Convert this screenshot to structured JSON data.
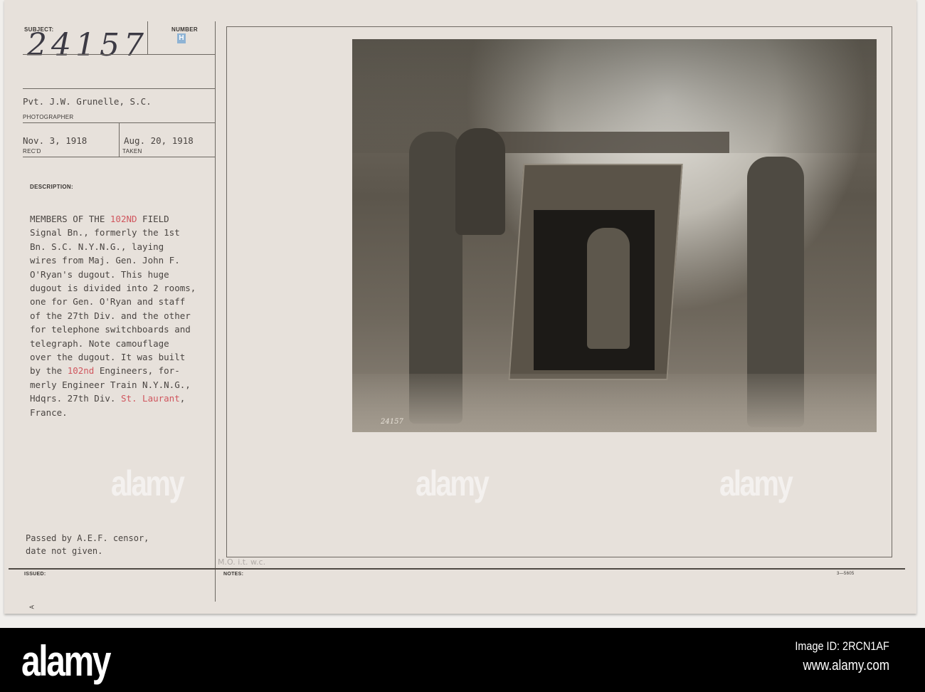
{
  "card": {
    "subject_label": "SUBJECT:",
    "subject_number": "24157",
    "number_label": "NUMBER",
    "number_stamp": "H",
    "photographer": "Pvt. J.W. Grunelle, S.C.",
    "photographer_label": "PHOTOGRAPHER",
    "received_date": "Nov. 3, 1918",
    "received_label": "REC'D",
    "taken_date": "Aug. 20, 1918",
    "taken_label": "TAKEN",
    "description_label": "DESCRIPTION:",
    "description_lines": [
      [
        "MEMBERS OF THE ",
        "102ND",
        " FIELD"
      ],
      [
        "Signal Bn., formerly the 1st"
      ],
      [
        "Bn. S.C. N.Y.N.G., laying"
      ],
      [
        "wires from Maj. Gen. John F."
      ],
      [
        "O'Ryan's dugout. This huge"
      ],
      [
        "dugout is divided into 2 rooms,"
      ],
      [
        "one for Gen. O'Ryan and staff"
      ],
      [
        "of the 27th Div. and the other"
      ],
      [
        "for telephone switchboards and"
      ],
      [
        "telegraph. Note camouflage"
      ],
      [
        "over the dugout. It was built"
      ],
      [
        "by the ",
        "102nd",
        " Engineers, for-"
      ],
      [
        "merly Engineer Train N.Y.N.G.,"
      ],
      [
        "Hdqrs. 27th Div. ",
        "St. Laurant",
        ","
      ],
      [
        "France."
      ]
    ],
    "censor_line1": "Passed by A.E.F. censor,",
    "censor_line2": "date not given.",
    "pencil_note": "M.O. i.t. w.c.",
    "issued_label": "ISSUED:",
    "notes_label": "NOTES:",
    "form_number": "3—5605",
    "corner_mark": "A",
    "photo_caption_number": "24157",
    "highlight_color": "#d0565e"
  },
  "footer": {
    "logo": "alamy",
    "image_id": "Image ID: 2RCN1AF",
    "url": "www.alamy.com",
    "watermark": "alamy"
  }
}
